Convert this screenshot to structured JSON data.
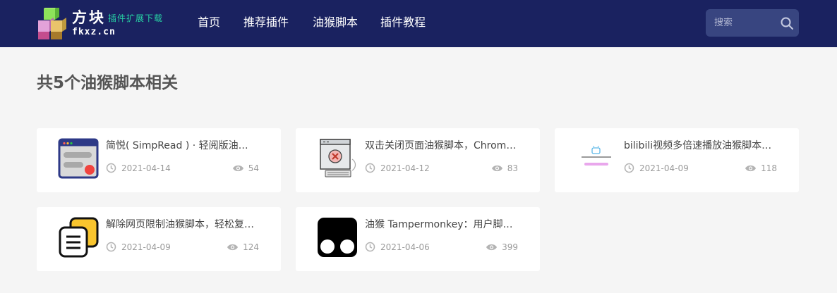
{
  "site": {
    "brand": "方块",
    "slogan": "插件扩展下载",
    "domain": "fkxz.cn"
  },
  "nav": {
    "items": [
      {
        "label": "首页"
      },
      {
        "label": "推荐插件"
      },
      {
        "label": "油猴脚本"
      },
      {
        "label": "插件教程"
      }
    ]
  },
  "search": {
    "placeholder": "搜索",
    "icon": "search-icon"
  },
  "results": {
    "heading": "共5个油猴脚本相关",
    "cards": [
      {
        "title": "简悦( SimpRead ) · 轻阅版油猴脚本",
        "date": "2021-04-14",
        "views": "54",
        "icon": "simpread-logo"
      },
      {
        "title": "双击关闭页面油猴脚本，Chrome浏览器双击关闭标签页",
        "date": "2021-04-12",
        "views": "83",
        "icon": "close-window-logo"
      },
      {
        "title": "bilibili视频多倍速播放油猴脚本，自定义倍速",
        "date": "2021-04-09",
        "views": "118",
        "icon": "bilibili-speed-logo"
      },
      {
        "title": "解除网页限制油猴脚本，轻松复制网页文字",
        "date": "2021-04-09",
        "views": "124",
        "icon": "unlock-copy-logo"
      },
      {
        "title": "油猴 Tampermonkey：用户脚本管理器",
        "date": "2021-04-06",
        "views": "399",
        "icon": "tampermonkey-logo"
      }
    ]
  },
  "colors": {
    "header_bg": "#1a2260",
    "accent_green": "#27d3a4",
    "page_bg": "#f5f5f5"
  }
}
